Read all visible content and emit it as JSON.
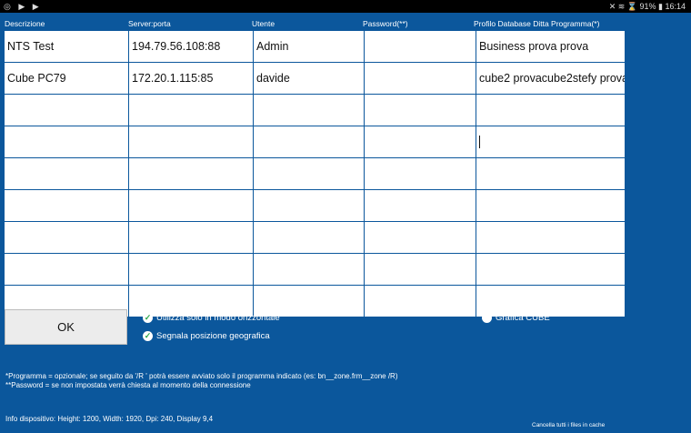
{
  "status_bar": {
    "left_icons": "◎ ▶ ▶",
    "right": "✕ ≋ ⌛ 91% ▮ 16:14"
  },
  "columns": [
    "Descrizione",
    "Server:porta",
    "Utente",
    "Password(**)",
    "Profilo Database Ditta Programma(*)"
  ],
  "rows": [
    [
      "NTS Test",
      "194.79.56.108:88",
      "Admin",
      "",
      "Business prova prova"
    ],
    [
      "Cube PC79",
      "172.20.1.115:85",
      "davide",
      "",
      "cube2 provacube2stefy prova"
    ],
    [
      "",
      "",
      "",
      "",
      ""
    ],
    [
      "",
      "",
      "",
      "",
      ""
    ],
    [
      "",
      "",
      "",
      "",
      ""
    ],
    [
      "",
      "",
      "",
      "",
      ""
    ],
    [
      "",
      "",
      "",
      "",
      ""
    ],
    [
      "",
      "",
      "",
      "",
      ""
    ],
    [
      "",
      "",
      "",
      "",
      ""
    ]
  ],
  "ok_label": "OK",
  "options": {
    "horizontal": "Utilizza solo in modo orizzontale",
    "geo": "Segnala posizione geografica",
    "cube": "Grafica CUBE"
  },
  "notes": [
    "*Programma = opzionale; se seguito da '/R ' potrà essere avviato solo il programma indicato (es: bn__zone.frm__zone /R)",
    "**Password  = se non impostata verrà chiesta al momento della connessione"
  ],
  "device_info": "Info dispositivo: Height: 1200, Width: 1920, Dpi: 240, Display 9,4",
  "clear_cache": "Cancella tutti i files in cache"
}
